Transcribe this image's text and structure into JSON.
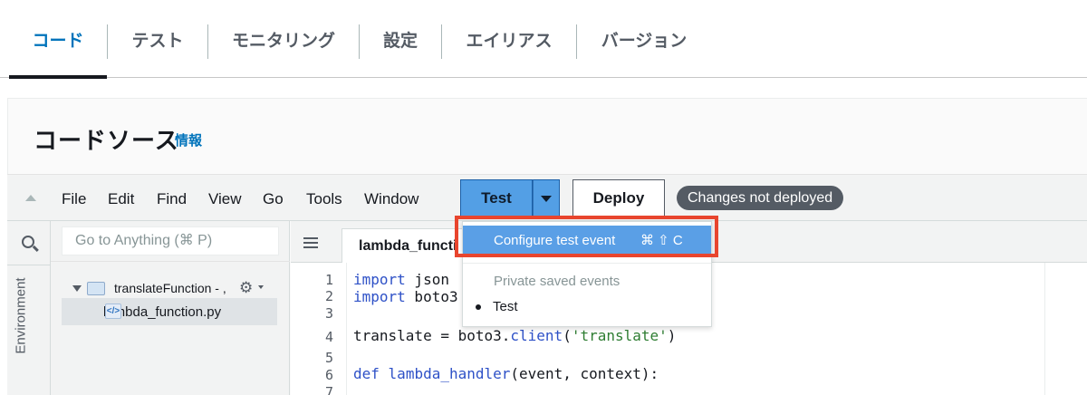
{
  "tabs": [
    {
      "label": "コード",
      "active": true
    },
    {
      "label": "テスト"
    },
    {
      "label": "モニタリング"
    },
    {
      "label": "設定"
    },
    {
      "label": "エイリアス"
    },
    {
      "label": "バージョン"
    }
  ],
  "panel": {
    "title": "コードソース",
    "info_link": "情報"
  },
  "menubar": {
    "items": [
      "File",
      "Edit",
      "Find",
      "View",
      "Go",
      "Tools",
      "Window"
    ],
    "test_button": "Test",
    "deploy_button": "Deploy",
    "status_badge": "Changes not deployed"
  },
  "sidebar": {
    "environment_label": "Environment"
  },
  "tree": {
    "search_placeholder": "Go to Anything (⌘ P)",
    "folder": "translateFunction - ,",
    "file": "lambda_function.py"
  },
  "editor": {
    "tab_label": "lambda_functi",
    "line_numbers": [
      "1",
      "2",
      "3",
      "4",
      "5",
      "6",
      "7"
    ]
  },
  "dropdown": {
    "active_item": "Configure test event",
    "shortcut": "⌘ ⇧ C",
    "section_header": "Private saved events",
    "items": [
      "Test"
    ]
  },
  "colors": {
    "accent": "#0073bb",
    "test_button": "#539fe5",
    "highlight": "#e8452e",
    "badge": "#545b64"
  }
}
